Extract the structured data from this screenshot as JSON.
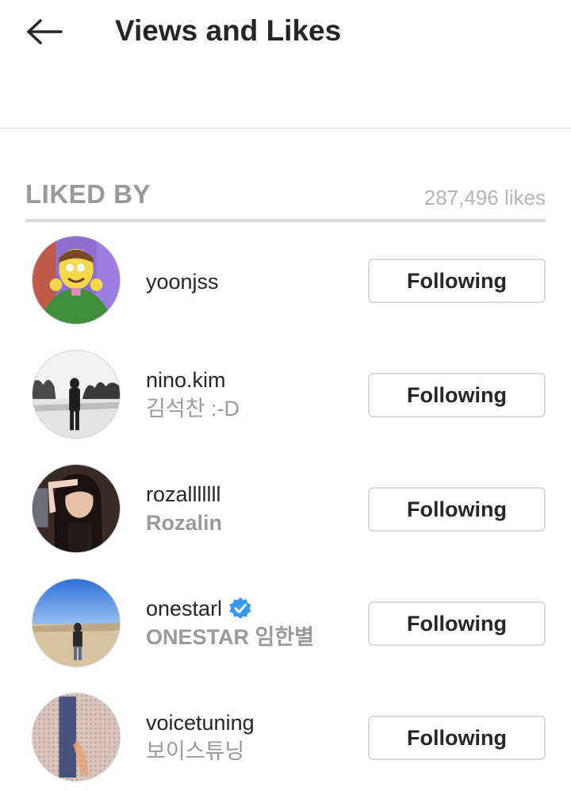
{
  "header": {
    "title": "Views and Likes"
  },
  "section": {
    "title": "LIKED BY",
    "likes_count": "287,496 likes"
  },
  "users": [
    {
      "username": "yoonjss",
      "fullname": "",
      "verified": false,
      "button_label": "Following"
    },
    {
      "username": "nino.kim",
      "fullname": "김석찬 :-D",
      "verified": false,
      "button_label": "Following"
    },
    {
      "username": "rozalllllll",
      "fullname": "Rozalin",
      "verified": false,
      "button_label": "Following"
    },
    {
      "username": "onestarl",
      "fullname": "ONESTAR 임한별",
      "verified": true,
      "button_label": "Following"
    },
    {
      "username": "voicetuning",
      "fullname": "보이스튜닝",
      "verified": false,
      "button_label": "Following"
    }
  ],
  "colors": {
    "verified_badge": "#3897f0",
    "divider": "#dbdbdb",
    "secondary_text": "#9a9a9a"
  }
}
